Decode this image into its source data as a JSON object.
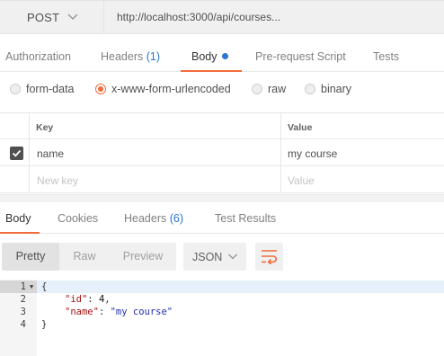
{
  "request": {
    "method": "POST",
    "url": "http://localhost:3000/api/courses..."
  },
  "request_tabs": [
    {
      "label": "Authorization",
      "count": ""
    },
    {
      "label": "Headers",
      "count": "(1)"
    },
    {
      "label": "Body",
      "count": "",
      "active": true
    },
    {
      "label": "Pre-request Script",
      "count": ""
    },
    {
      "label": "Tests",
      "count": ""
    }
  ],
  "body_types": [
    {
      "label": "form-data",
      "selected": false
    },
    {
      "label": "x-www-form-urlencoded",
      "selected": true
    },
    {
      "label": "raw",
      "selected": false
    },
    {
      "label": "binary",
      "selected": false
    }
  ],
  "params_table": {
    "headers": {
      "key": "Key",
      "value": "Value"
    },
    "rows": [
      {
        "checked": true,
        "key": "name",
        "value": "my course"
      }
    ],
    "placeholder": {
      "key": "New key",
      "value": "Value"
    }
  },
  "response_tabs": [
    {
      "label": "Body",
      "count": "",
      "active": true
    },
    {
      "label": "Cookies",
      "count": ""
    },
    {
      "label": "Headers",
      "count": "(6)"
    },
    {
      "label": "Test Results",
      "count": ""
    }
  ],
  "view_modes": [
    "Pretty",
    "Raw",
    "Preview"
  ],
  "active_view_mode": "Pretty",
  "format": "JSON",
  "response_code": {
    "line_numbers": [
      "1",
      "2",
      "3",
      "4"
    ],
    "line1": "{",
    "id_key": "\"id\"",
    "id_value": "4",
    "name_key": "\"name\"",
    "name_value": "\"my course\"",
    "line4": "}"
  },
  "colors": {
    "accent": "#f26b3a",
    "link_blue": "#2a75d0",
    "string_blue": "#1f2fb0",
    "key_red": "#a31515"
  },
  "icons": [
    "chevron-down-icon",
    "checkmark-icon",
    "wrap-lines-icon",
    "fold-arrow-icon"
  ]
}
